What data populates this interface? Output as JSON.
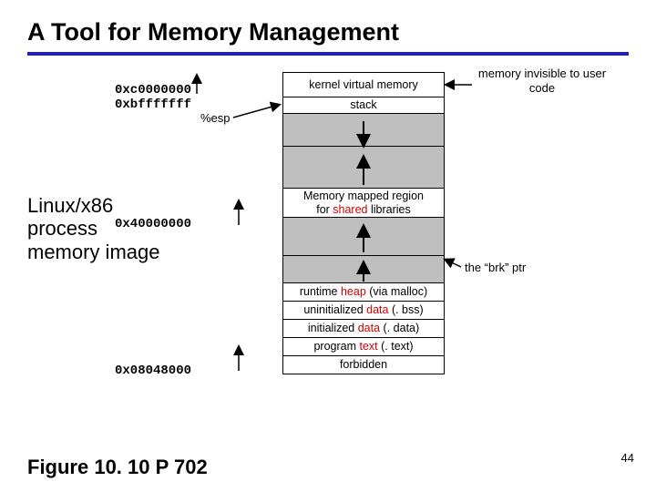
{
  "title": "A Tool for Memory Management",
  "sideText": "Linux/x86 process memory image",
  "addrs": {
    "kernelTop": "0xc0000000",
    "stackTop": "0xbfffffff",
    "sharedLib": "0x40000000",
    "textStart": "0x08048000"
  },
  "esp": "%esp",
  "regions": {
    "kernel": "kernel virtual memory",
    "stack": "stack",
    "mmap_pre": "Memory mapped region",
    "mmap_for": "for ",
    "mmap_shared": "shared",
    "mmap_lib": " libraries",
    "heap_pre": "runtime ",
    "heap_red": "heap",
    "heap_post": " (via malloc)",
    "bss_pre": "uninitialized ",
    "bss_red": "data",
    "bss_post": " (. bss)",
    "data_pre": "initialized ",
    "data_red": "data",
    "data_post": " (. data)",
    "text_pre": "program ",
    "text_red": "text",
    "text_post": " (. text)",
    "forbidden": "forbidden"
  },
  "notes": {
    "kernelNote": "memory invisible to user code",
    "brk": "the “brk” ptr"
  },
  "figref": "Figure 10. 10   P 702",
  "pagenum": "44",
  "chart_data": {
    "type": "diagram",
    "title": "Linux/x86 process virtual address space layout",
    "regions_top_to_bottom": [
      {
        "label": "kernel virtual memory",
        "top_addr": null,
        "bottom_addr": "0xc0000000",
        "note": "memory invisible to user code"
      },
      {
        "label": "stack",
        "top_addr": "0xbfffffff",
        "growth": "down",
        "pointer": "%esp"
      },
      {
        "label": "Memory mapped region for shared libraries",
        "top_addr": "0x40000000"
      },
      {
        "label": "runtime heap (via malloc)",
        "growth": "up",
        "pointer": "the \"brk\" ptr"
      },
      {
        "label": "uninitialized data (.bss)"
      },
      {
        "label": "initialized data (.data)"
      },
      {
        "label": "program text (.text)",
        "bottom_addr": "0x08048000"
      },
      {
        "label": "forbidden"
      }
    ],
    "source_ref": "Figure 10.10 P 702"
  }
}
